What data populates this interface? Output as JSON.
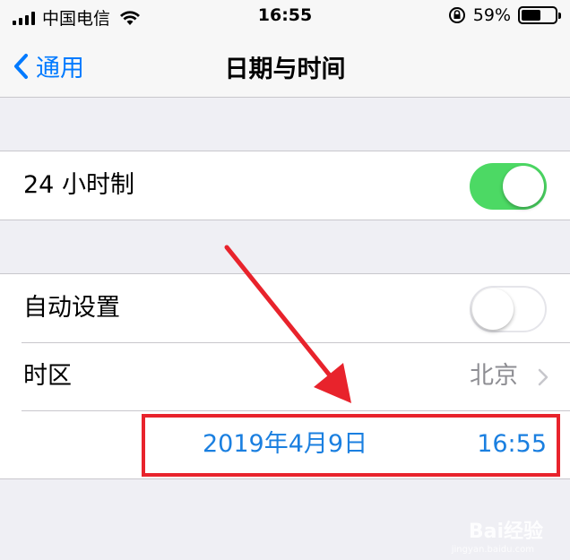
{
  "status_bar": {
    "carrier": "中国电信",
    "time": "16:55",
    "battery_percent": "59%",
    "battery_level": 0.59,
    "icons": [
      "signal-bars-icon",
      "wifi-icon",
      "rotation-lock-icon",
      "battery-icon"
    ]
  },
  "nav": {
    "back_label": "通用",
    "title": "日期与时间"
  },
  "settings": {
    "clock24_label": "24 小时制",
    "clock24_on": true,
    "auto_set_label": "自动设置",
    "auto_set_on": false,
    "timezone_label": "时区",
    "timezone_value": "北京",
    "date_value": "2019年4月9日",
    "time_value": "16:55"
  },
  "colors": {
    "accent": "#007aff",
    "toggle_on": "#4cd964",
    "date_time_text": "#1a7fe0",
    "annotation": "#e8232c",
    "background": "#efeff4"
  },
  "watermark": {
    "brand": "Bai经验",
    "url": "jingyan.baidu.com"
  }
}
